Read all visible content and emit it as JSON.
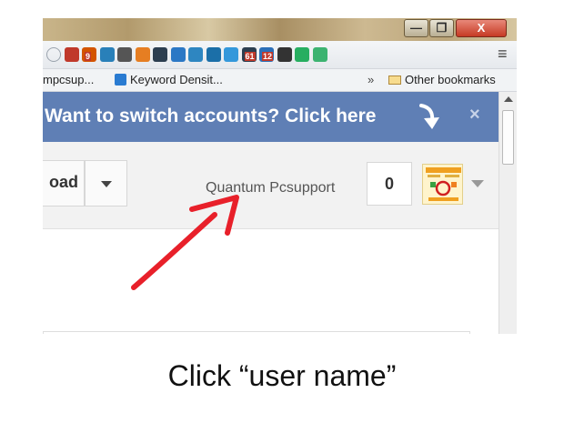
{
  "window_controls": {
    "minimize": "—",
    "maximize": "❐",
    "close": "X"
  },
  "toolbar": {
    "extensions": [
      {
        "name": "star-icon",
        "color": "#9aa3ad"
      },
      {
        "name": "book-icon",
        "color": "#c0392b"
      },
      {
        "name": "download-9-icon",
        "color": "#d35400",
        "badge": "9"
      },
      {
        "name": "screen-icon",
        "color": "#2980b9"
      },
      {
        "name": "bug-icon",
        "color": "#555555"
      },
      {
        "name": "fox-icon",
        "color": "#e67e22"
      },
      {
        "name": "at-icon",
        "color": "#2c3e50"
      },
      {
        "name": "m-icon",
        "color": "#2b78c5"
      },
      {
        "name": "pen-icon",
        "color": "#2e86c1"
      },
      {
        "name": "target-icon",
        "color": "#1b6fa8"
      },
      {
        "name": "check-icon",
        "color": "#3498db"
      },
      {
        "name": "calendar-61-icon",
        "color": "#2c3e50",
        "badge": "61"
      },
      {
        "name": "tweet-12-icon",
        "color": "#2c6fb7",
        "badge": "12"
      },
      {
        "name": "layers-icon",
        "color": "#333333"
      },
      {
        "name": "plus-circle-icon",
        "color": "#27ae60"
      },
      {
        "name": "green-box-icon",
        "color": "#3cb371"
      }
    ],
    "menu_icon": "≡"
  },
  "bookmarks": {
    "item1": "mpcsup...",
    "item2": "Keyword Densit...",
    "overflow": "»",
    "other": "Other bookmarks"
  },
  "banner": {
    "text": "Want to switch accounts? Click here",
    "close": "×"
  },
  "topbar": {
    "load_label": "oad",
    "username": "Quantum Pcsupport",
    "count": "0"
  },
  "caption": "Click “user name”",
  "colors": {
    "banner": "#5f7fb5",
    "annotation_arrow": "#e8202a"
  }
}
